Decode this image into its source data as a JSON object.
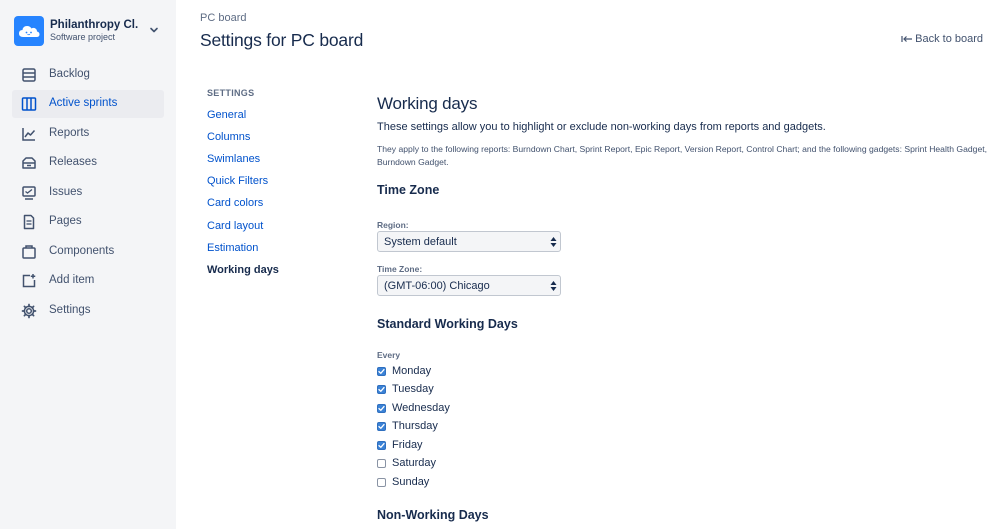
{
  "project": {
    "name": "Philanthropy Cl...",
    "type": "Software project",
    "avatar_color": "#2684ff"
  },
  "sidebar": {
    "items": [
      {
        "label": "Backlog",
        "icon": "backlog-icon"
      },
      {
        "label": "Active sprints",
        "icon": "board-icon",
        "active": true
      },
      {
        "label": "Reports",
        "icon": "reports-icon"
      },
      {
        "label": "Releases",
        "icon": "releases-icon"
      },
      {
        "label": "Issues",
        "icon": "issues-icon"
      },
      {
        "label": "Pages",
        "icon": "pages-icon"
      },
      {
        "label": "Components",
        "icon": "components-icon"
      },
      {
        "label": "Add item",
        "icon": "add-item-icon"
      },
      {
        "label": "Settings",
        "icon": "gear-icon"
      }
    ]
  },
  "header": {
    "breadcrumb": "PC board",
    "title": "Settings for PC board",
    "back_link": "Back to board"
  },
  "settings_nav": {
    "heading": "SETTINGS",
    "items": [
      {
        "label": "General"
      },
      {
        "label": "Columns"
      },
      {
        "label": "Swimlanes"
      },
      {
        "label": "Quick Filters"
      },
      {
        "label": "Card colors"
      },
      {
        "label": "Card layout"
      },
      {
        "label": "Estimation"
      },
      {
        "label": "Working days",
        "current": true
      }
    ]
  },
  "main": {
    "title": "Working days",
    "intro": "These settings allow you to highlight or exclude non-working days from reports and gadgets.",
    "note": "They apply to the following reports: Burndown Chart, Sprint Report, Epic Report, Version Report, Control Chart; and the following gadgets: Sprint Health Gadget, Burndown Gadget.",
    "time_zone": {
      "heading": "Time Zone",
      "region_label": "Region:",
      "region_value": "System default",
      "tz_label": "Time Zone:",
      "tz_value": "(GMT-06:00) Chicago"
    },
    "working_days": {
      "heading": "Standard Working Days",
      "every_label": "Every",
      "days": [
        {
          "label": "Monday",
          "checked": true
        },
        {
          "label": "Tuesday",
          "checked": true
        },
        {
          "label": "Wednesday",
          "checked": true
        },
        {
          "label": "Thursday",
          "checked": true
        },
        {
          "label": "Friday",
          "checked": true
        },
        {
          "label": "Saturday",
          "checked": false
        },
        {
          "label": "Sunday",
          "checked": false
        }
      ]
    },
    "non_working_heading": "Non-Working Days"
  },
  "colors": {
    "link": "#0052cc",
    "checkbox_checked": "#3b82d6",
    "sidebar_bg": "#f4f5f7"
  }
}
